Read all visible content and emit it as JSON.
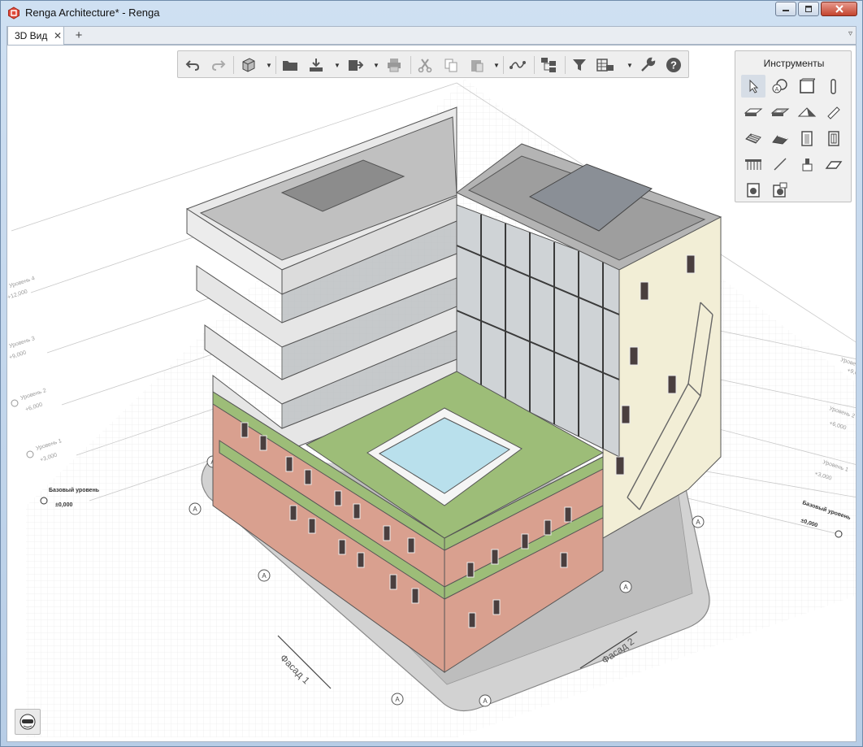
{
  "window": {
    "title": "Renga Architecture* - Renga",
    "controls": [
      "minimize-button",
      "maximize-button",
      "close-button"
    ]
  },
  "tabs": {
    "active_label": "3D Вид",
    "close_glyph": "✕",
    "add_glyph": "+",
    "menu_glyph": "▿"
  },
  "toolbar": {
    "buttons": [
      "undo",
      "redo",
      "view-cube",
      "open-folder",
      "import",
      "export",
      "print",
      "cut",
      "copy",
      "paste",
      "connect",
      "model-structure",
      "filter",
      "visibility-table",
      "settings",
      "help"
    ],
    "help_label": "?"
  },
  "tools_panel": {
    "title": "Инструменты",
    "tools": [
      "select",
      "annotation",
      "wall",
      "column",
      "floor",
      "opening",
      "roof",
      "beam",
      "stair",
      "ramp",
      "door",
      "window",
      "railing",
      "line",
      "equipment",
      "elements",
      "plumbing",
      "assembly"
    ]
  },
  "levels_left": [
    {
      "name": "Уровень 4",
      "elev": "+12,000"
    },
    {
      "name": "Уровень 3",
      "elev": "+9,000"
    },
    {
      "name": "Уровень 2",
      "elev": "+6,000"
    },
    {
      "name": "Уровень 1",
      "elev": "+3,000"
    },
    {
      "name": "Базовый уровень",
      "elev": "±0,000"
    }
  ],
  "levels_right": [
    {
      "name": "Уровень 3",
      "elev": "+9,000"
    },
    {
      "name": "Уровень 2",
      "elev": "+6,000"
    },
    {
      "name": "Уровень 1",
      "elev": "+3,000"
    },
    {
      "name": "Базовый уровень",
      "elev": "±0,000"
    }
  ],
  "grid_axis_label": "A",
  "facades": [
    "Фасад 1",
    "Фасад 2"
  ],
  "colors": {
    "accent_close": "#c3442e",
    "brick": "#d9a08f",
    "green_roof": "#9dbd78",
    "pool_water": "#b9e0ec",
    "facade_cream": "#f2eed6"
  }
}
